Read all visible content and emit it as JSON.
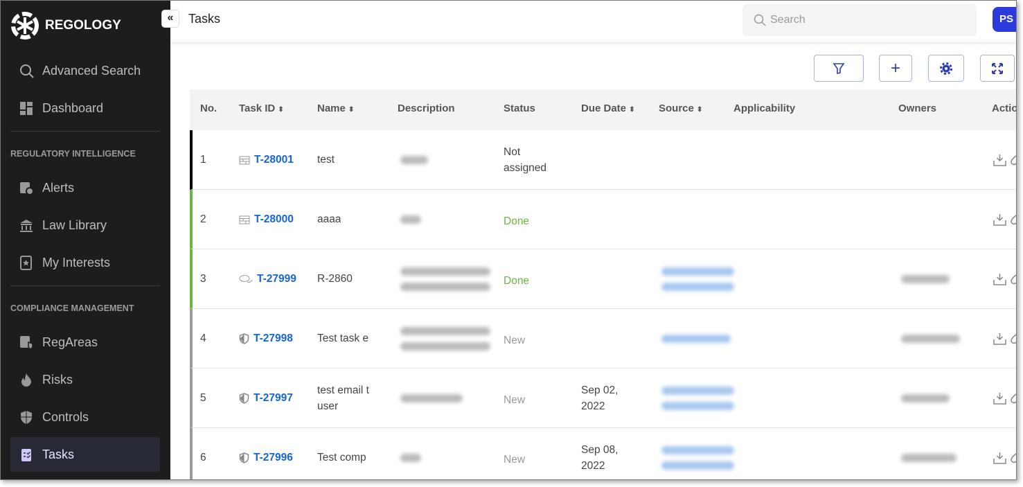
{
  "brand": {
    "name": "REGOLOGY"
  },
  "sidebar": {
    "top": [
      {
        "label": "Advanced Search",
        "icon": "search-icon"
      },
      {
        "label": "Dashboard",
        "icon": "dashboard-icon"
      }
    ],
    "sections": [
      {
        "title": "REGULATORY INTELLIGENCE",
        "items": [
          {
            "label": "Alerts",
            "icon": "alert-icon"
          },
          {
            "label": "Law Library",
            "icon": "library-icon"
          },
          {
            "label": "My Interests",
            "icon": "star-book-icon"
          }
        ]
      },
      {
        "title": "COMPLIANCE MANAGEMENT",
        "items": [
          {
            "label": "RegAreas",
            "icon": "regareas-icon"
          },
          {
            "label": "Risks",
            "icon": "flame-icon"
          },
          {
            "label": "Controls",
            "icon": "shield-icon"
          },
          {
            "label": "Tasks",
            "icon": "clipboard-icon",
            "active": true
          }
        ]
      }
    ]
  },
  "header": {
    "title": "Tasks",
    "search_placeholder": "Search",
    "avatar": "PS"
  },
  "colors": {
    "accent": "#2a3adb",
    "link": "#1565d8",
    "done": "#6db33f",
    "sidebar": "#1c1d1f"
  },
  "table": {
    "columns": [
      "No.",
      "Task ID",
      "Name",
      "Description",
      "Status",
      "Due Date",
      "Source",
      "Applicability",
      "Owners",
      "Actio"
    ],
    "rows": [
      {
        "no": "1",
        "id": "T-28001",
        "type": "list",
        "name": "test",
        "status": "Not assigned",
        "due": "",
        "bar": "#000000"
      },
      {
        "no": "2",
        "id": "T-28000",
        "type": "list",
        "name": "aaaa",
        "status": "Done",
        "due": "",
        "bar": "#6db33f"
      },
      {
        "no": "3",
        "id": "T-27999",
        "type": "comment",
        "name": "R-2860",
        "status": "Done",
        "due": "",
        "bar": "#6db33f"
      },
      {
        "no": "4",
        "id": "T-27998",
        "type": "shield",
        "name": "Test task e",
        "status": "New",
        "due": "",
        "bar": "#999999"
      },
      {
        "no": "5",
        "id": "T-27997",
        "type": "shield",
        "name": "test email t\nuser",
        "status": "New",
        "due": "Sep 02,\n2022",
        "bar": "#999999"
      },
      {
        "no": "6",
        "id": "T-27996",
        "type": "shield",
        "name": "Test comp",
        "status": "New",
        "due": "Sep 08,\n2022",
        "bar": "#999999"
      }
    ]
  }
}
